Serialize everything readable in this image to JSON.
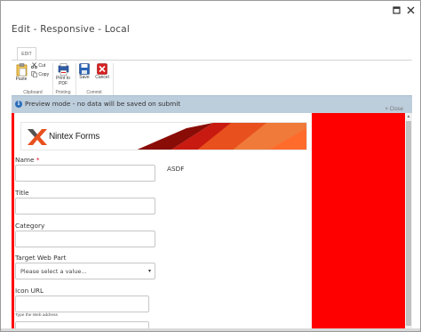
{
  "window": {
    "title": "Edit - Responsive - Local",
    "maximize_icon": "maximize-icon",
    "close_icon": "close-icon"
  },
  "ribbon": {
    "tab_label": "EDIT",
    "paste_label": "Paste",
    "cut_label": "Cut",
    "copy_label": "Copy",
    "print_label_line1": "Print to",
    "print_label_line2": "PDF",
    "save_label": "Save",
    "cancel_label": "Cancel",
    "groups": [
      "Clipboard",
      "Printing",
      "Commit"
    ]
  },
  "preview": {
    "message": "Preview mode - no data will be saved on submit",
    "close_label": "× Close",
    "info_icon": "info-icon"
  },
  "form": {
    "brand": "Nintex Forms",
    "name_label": "Name",
    "required_marker": "*",
    "asdf_value": "ASDF",
    "title_label": "Title",
    "category_label": "Category",
    "target_label": "Target Web Part",
    "target_value": "Please select a value...",
    "icon_label": "Icon URL",
    "icon_hint": "Type the Web address"
  },
  "colors": {
    "brand_red": "#ff0000",
    "info_bar": "#bccddc",
    "accent_orange": "#e8501e"
  }
}
